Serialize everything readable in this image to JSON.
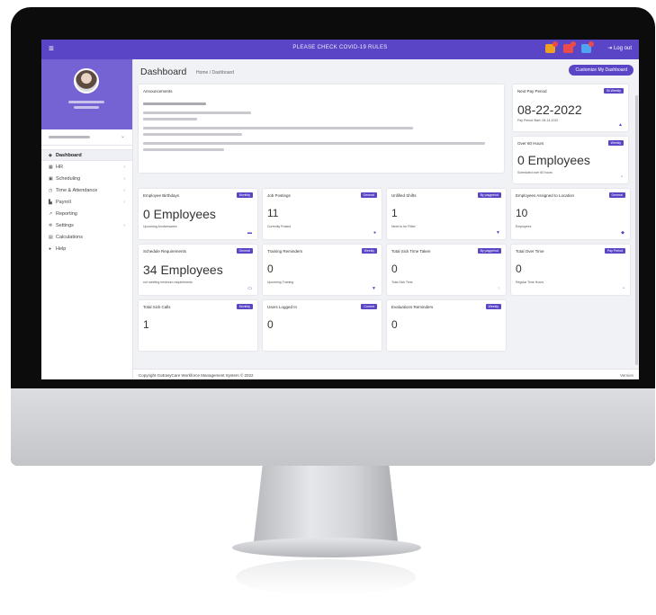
{
  "topbar": {
    "menu_icon": "≡",
    "banner": "PLEASE CHECK COVID-19 RULES",
    "logout_label": "Log out"
  },
  "sidebar": {
    "dept_caret": "⌄",
    "items": [
      {
        "label": "Dashboard",
        "icon": "dashboard-icon",
        "glyph": "◆",
        "chevron": ""
      },
      {
        "label": "HR",
        "icon": "hr-icon",
        "glyph": "▦",
        "chevron": "‹"
      },
      {
        "label": "Scheduling",
        "icon": "calendar-icon",
        "glyph": "▣",
        "chevron": "‹"
      },
      {
        "label": "Time & Attendance",
        "icon": "clock-icon",
        "glyph": "◷",
        "chevron": "‹"
      },
      {
        "label": "Payroll",
        "icon": "payroll-icon",
        "glyph": "▙",
        "chevron": "‹"
      },
      {
        "label": "Reporting",
        "icon": "chart-icon",
        "glyph": "↗",
        "chevron": ""
      },
      {
        "label": "Settings",
        "icon": "gear-icon",
        "glyph": "✲",
        "chevron": "‹"
      },
      {
        "label": "Calculations",
        "icon": "calculator-icon",
        "glyph": "▤",
        "chevron": ""
      },
      {
        "label": "Help",
        "icon": "help-icon",
        "glyph": "●",
        "chevron": ""
      }
    ]
  },
  "header": {
    "title": "Dashboard",
    "breadcrumb": "Home / Dashboard",
    "customize_label": "Customize My Dashboard"
  },
  "announcements": {
    "title": "Announcements"
  },
  "cards": {
    "pay_period": {
      "title": "Next Pay Period",
      "badge": "Bi-Weekly",
      "value": "08-22-2022",
      "sub": "Pay Period Start: 08-14-2022",
      "glyph": "▲"
    },
    "over60": {
      "title": "Over 60 Hours",
      "badge": "Weekly",
      "value": "0 Employees",
      "sub": "Scheduled over 60 hours",
      "glyph": "◔"
    },
    "birthdays": {
      "title": "Employee Birthdays",
      "badge": "Monthly",
      "value": "0 Employees",
      "sub": "Upcoming Anniversaries",
      "glyph": "▬"
    },
    "jobs": {
      "title": "Job Postings",
      "badge": "General",
      "value": "11",
      "sub": "Currently Posted",
      "glyph": "●"
    },
    "unfilled": {
      "title": "Unfilled Shifts",
      "badge": "By paygeriod",
      "value": "1",
      "sub": "Need to be Filled",
      "glyph": "▼"
    },
    "assigned": {
      "title": "Employees Assigned to Location",
      "badge": "General",
      "value": "10",
      "sub": "Employees",
      "glyph": "◆"
    },
    "sched_req": {
      "title": "Schedule Requirements",
      "badge": "General",
      "value": "34 Employees",
      "sub": "not meeting minimum requirements",
      "glyph": "▭"
    },
    "training": {
      "title": "Training Reminders",
      "badge": "Weekly",
      "value": "0",
      "sub": "Upcoming Training",
      "glyph": "▼"
    },
    "sick_time": {
      "title": "Total Sick Time Taken",
      "badge": "By paygeriod",
      "value": "0",
      "sub": "Total Sick Time",
      "glyph": "◌"
    },
    "overtime": {
      "title": "Total Over Time",
      "badge": "Pay Period",
      "value": "0",
      "sub": "Regular Time Hours",
      "glyph": "◔"
    },
    "sick_calls": {
      "title": "Total Sick Calls",
      "badge": "Monthly",
      "value": "1"
    },
    "logged_in": {
      "title": "Users Logged In",
      "badge": "Current",
      "value": "0"
    },
    "evaluations": {
      "title": "Evaluations Reminders",
      "badge": "Weekly",
      "value": "0"
    }
  },
  "footer": {
    "copyright": "Copyright GoEasyCare Workforce Management System © 2022",
    "version": "Version"
  },
  "colors": {
    "accent": "#5b45c7",
    "profile_bg": "#7663d3"
  }
}
